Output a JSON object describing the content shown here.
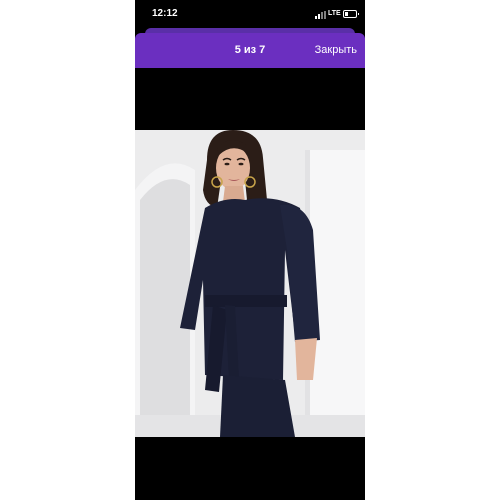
{
  "status_bar": {
    "time": "12:12",
    "network": "LTE",
    "battery_icon": "battery-icon",
    "signal_icon": "signal-icon"
  },
  "header": {
    "counter": "5 из 7",
    "close_label": "Закрыть",
    "accent_color": "#6b2fc0"
  },
  "viewer": {
    "image_icon": "product-photo",
    "background": "#000000"
  }
}
